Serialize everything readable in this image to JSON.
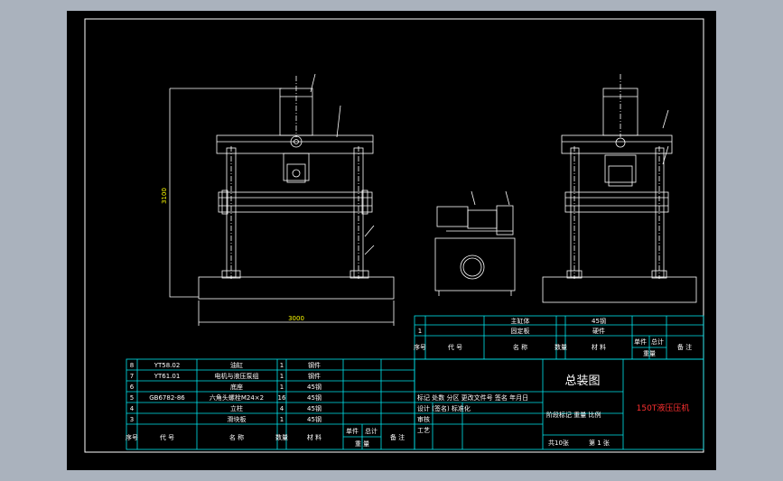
{
  "drawing_title": "总装图",
  "product_name": "150T液压压机",
  "dimensions": {
    "height": "3100",
    "width": "3000"
  },
  "upper_rows": [
    {
      "no": "",
      "code": "",
      "name": "主缸体",
      "qty": "",
      "material": "45钢"
    },
    {
      "no": "1",
      "code": "",
      "name": "固定板",
      "qty": "",
      "material": "硬件"
    }
  ],
  "upper_header": {
    "no": "序号",
    "code": "代  号",
    "name": "名  称",
    "qty": "数量",
    "material": "材  料",
    "unit_weight": "单件",
    "total_weight": "总计",
    "weight": "重量",
    "remark": "备 注"
  },
  "parts": [
    {
      "no": "8",
      "code": "YT58.02",
      "name": "油缸",
      "qty": "1",
      "material": "钢件"
    },
    {
      "no": "7",
      "code": "YT61.01",
      "name": "电机与液压泵组",
      "qty": "1",
      "material": "钢件"
    },
    {
      "no": "6",
      "code": "",
      "name": "底座",
      "qty": "1",
      "material": "45钢"
    },
    {
      "no": "5",
      "code": "GB6782-86",
      "name": "六角头螺栓M24×2",
      "qty": "16",
      "material": "45钢"
    },
    {
      "no": "4",
      "code": "",
      "name": "立柱",
      "qty": "4",
      "material": "45钢"
    },
    {
      "no": "3",
      "code": "",
      "name": "滑块板",
      "qty": "1",
      "material": "45钢"
    }
  ],
  "parts_header": {
    "no": "序号",
    "code": "代  号",
    "name": "名  称",
    "qty": "数量",
    "material": "材  料",
    "unit_weight": "单件",
    "total_weight": "总计",
    "weight": "重 量",
    "remark": "备 注"
  },
  "title_block": {
    "row1": "标记 处数 分区 更改文件号 签名 年月日",
    "row2": "设计 (签名)  标准化",
    "row3": "审核",
    "row4": "工艺",
    "stage": "阶段标记  重量  比例",
    "sheets_total": "共10张",
    "sheet_no": "第 1 张"
  }
}
